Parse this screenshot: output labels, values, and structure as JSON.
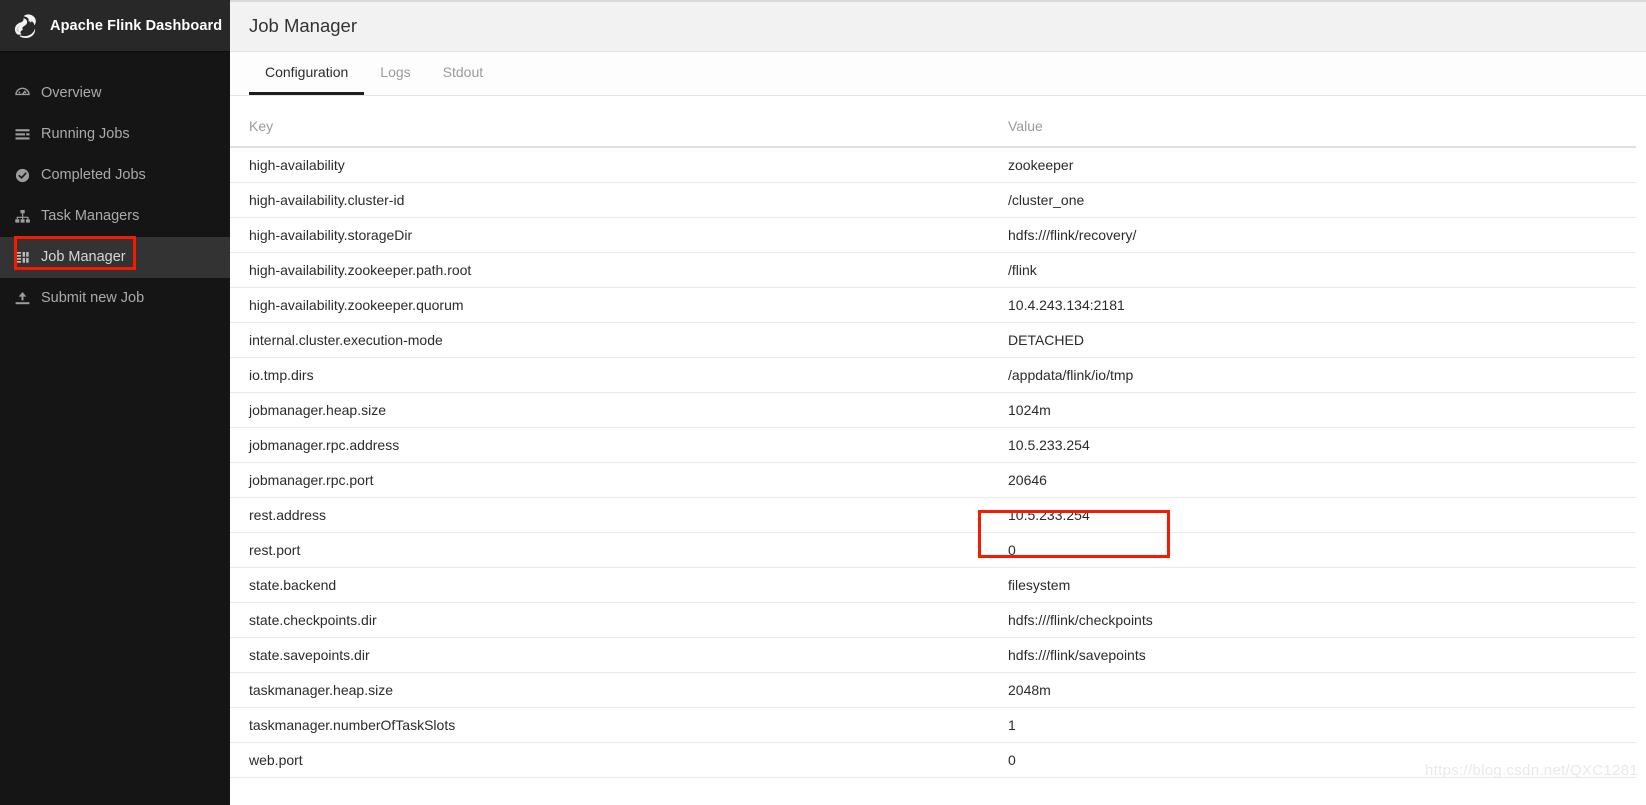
{
  "brand": {
    "title": "Apache Flink Dashboard",
    "logo_icon": "flink-squirrel-icon"
  },
  "sidebar": {
    "items": [
      {
        "label": "Overview",
        "icon": "dashboard-gauge-icon",
        "active": false
      },
      {
        "label": "Running Jobs",
        "icon": "list-bars-icon",
        "active": false
      },
      {
        "label": "Completed Jobs",
        "icon": "check-circle-icon",
        "active": false
      },
      {
        "label": "Task Managers",
        "icon": "sitemap-icon",
        "active": false
      },
      {
        "label": "Job Manager",
        "icon": "server-rack-icon",
        "active": true
      },
      {
        "label": "Submit new Job",
        "icon": "upload-icon",
        "active": false
      }
    ]
  },
  "header": {
    "title": "Job Manager"
  },
  "tabs": [
    {
      "label": "Configuration",
      "active": true
    },
    {
      "label": "Logs",
      "active": false
    },
    {
      "label": "Stdout",
      "active": false
    }
  ],
  "table": {
    "columns": [
      "Key",
      "Value"
    ],
    "rows": [
      {
        "key": "high-availability",
        "value": "zookeeper"
      },
      {
        "key": "high-availability.cluster-id",
        "value": "/cluster_one"
      },
      {
        "key": "high-availability.storageDir",
        "value": "hdfs:///flink/recovery/"
      },
      {
        "key": "high-availability.zookeeper.path.root",
        "value": "/flink"
      },
      {
        "key": "high-availability.zookeeper.quorum",
        "value": "10.4.243.134:2181"
      },
      {
        "key": "internal.cluster.execution-mode",
        "value": "DETACHED"
      },
      {
        "key": "io.tmp.dirs",
        "value": "/appdata/flink/io/tmp"
      },
      {
        "key": "jobmanager.heap.size",
        "value": "1024m"
      },
      {
        "key": "jobmanager.rpc.address",
        "value": "10.5.233.254"
      },
      {
        "key": "jobmanager.rpc.port",
        "value": "20646"
      },
      {
        "key": "rest.address",
        "value": "10.5.233.254"
      },
      {
        "key": "rest.port",
        "value": "0"
      },
      {
        "key": "state.backend",
        "value": "filesystem"
      },
      {
        "key": "state.checkpoints.dir",
        "value": "hdfs:///flink/checkpoints"
      },
      {
        "key": "state.savepoints.dir",
        "value": "hdfs:///flink/savepoints"
      },
      {
        "key": "taskmanager.heap.size",
        "value": "2048m"
      },
      {
        "key": "taskmanager.numberOfTaskSlots",
        "value": "1"
      },
      {
        "key": "web.port",
        "value": "0"
      }
    ]
  },
  "annotations": {
    "highlight_color": "#f61b00",
    "sidebar_highlight_target": "Job Manager",
    "value_highlight_target": "10.5.233.254"
  },
  "watermark": {
    "text": "https://blog.csdn.net/QXC1281"
  }
}
